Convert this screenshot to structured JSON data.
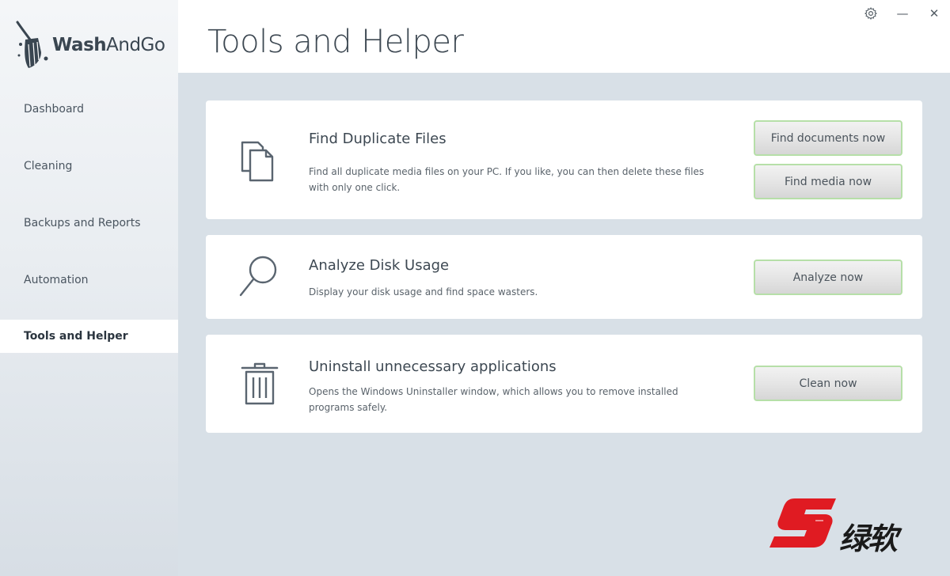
{
  "app": {
    "logo_wash": "Wash",
    "logo_and": "AndGo"
  },
  "sidebar": {
    "items": [
      {
        "label": "Dashboard"
      },
      {
        "label": "Cleaning"
      },
      {
        "label": "Backups and Reports"
      },
      {
        "label": "Automation"
      },
      {
        "label": "Tools and Helper",
        "active": true
      }
    ]
  },
  "header": {
    "title": "Tools and Helper"
  },
  "window_controls": {
    "settings_icon": "gear-icon",
    "minimize": "—",
    "close": "✕"
  },
  "cards": [
    {
      "icon": "duplicate-files-icon",
      "title": "Find Duplicate Files",
      "description": "Find all duplicate media files on your PC. If you like, you can then delete these files with only one click.",
      "buttons": [
        "Find documents now",
        "Find media now"
      ]
    },
    {
      "icon": "magnifier-icon",
      "title": "Analyze Disk Usage",
      "description": "Display your disk usage and find space wasters.",
      "buttons": [
        "Analyze now"
      ]
    },
    {
      "icon": "trash-icon",
      "title": "Uninstall unnecessary applications",
      "description": "Opens the Windows Uninstaller window, which allows you to remove installed programs safely.",
      "buttons": [
        "Clean now"
      ]
    }
  ],
  "colors": {
    "accent_border": "#b6dfa8",
    "content_bg": "#d8e0e7",
    "watermark_red": "#e01b22"
  },
  "watermark": {
    "text": "绿软"
  }
}
